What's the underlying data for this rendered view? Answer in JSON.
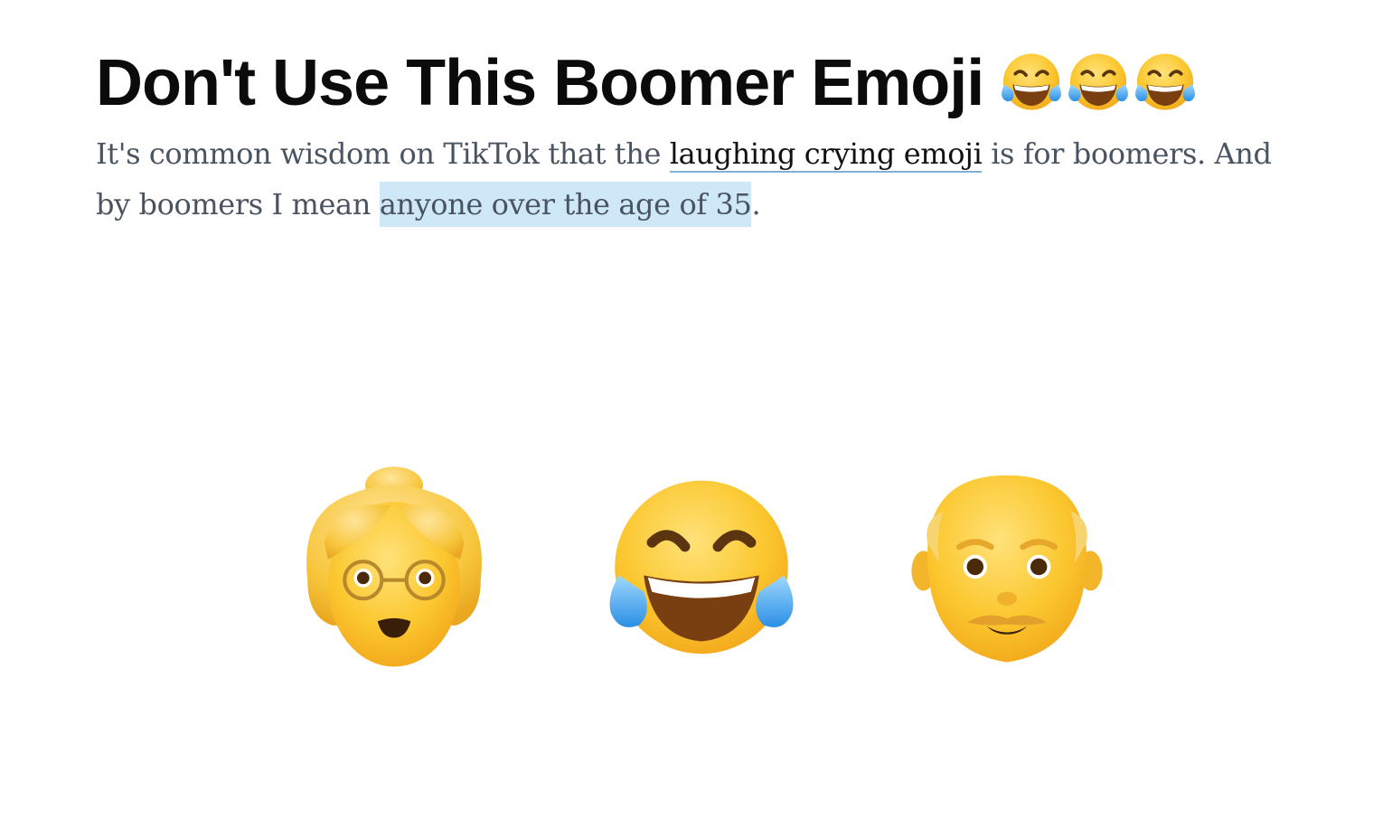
{
  "article": {
    "title": "Don't Use This Boomer Emoji",
    "lede_part1": "It's common wisdom on TikTok that the ",
    "lede_link": "laughing crying emoji",
    "lede_part2": " is for boomers. And by boomers I mean ",
    "lede_highlight": "anyone over the age of 35",
    "lede_part3": "."
  },
  "emojis": {
    "title_icons": [
      "laughing-crying-emoji",
      "laughing-crying-emoji",
      "laughing-crying-emoji"
    ],
    "illustration": [
      "old-woman-emoji",
      "laughing-crying-emoji",
      "old-man-emoji"
    ]
  },
  "colors": {
    "title": "#0b0b0b",
    "body": "#4a5461",
    "link_underline": "#7fb2d8",
    "highlight": "#cfe8f8",
    "emoji_yellow": "#f9c22a"
  }
}
